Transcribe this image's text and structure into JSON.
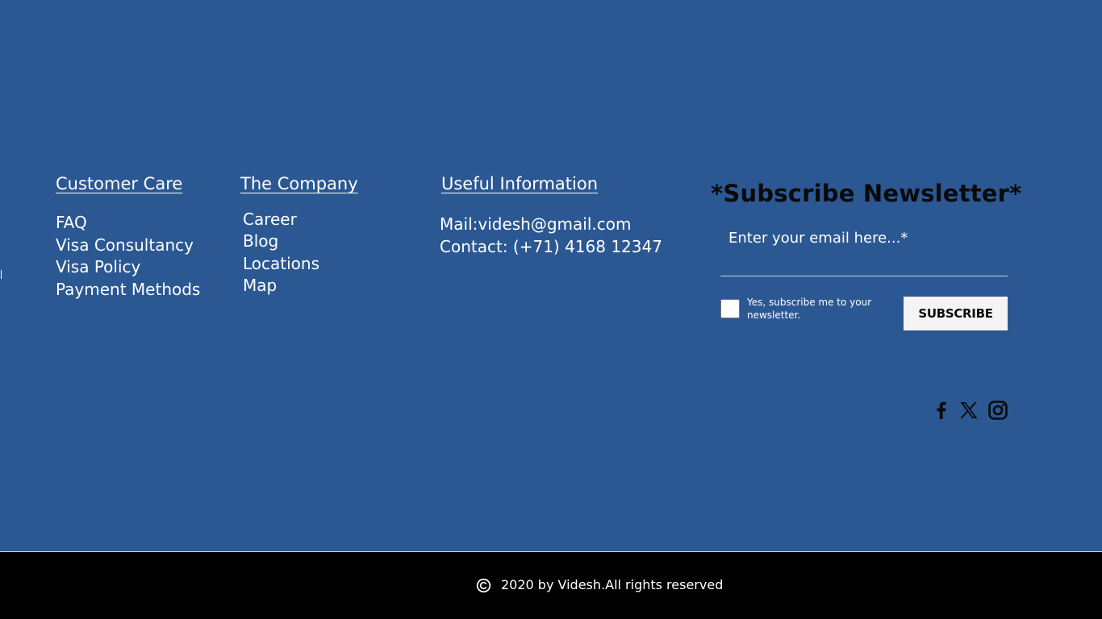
{
  "theme": {
    "background": "#2b5893",
    "text": "#ffffff",
    "title_text": "#0a0a0a",
    "footer_background": "#000000",
    "button_background": "#f4f4f4"
  },
  "customer_care": {
    "heading": "Customer Care",
    "items": [
      {
        "label": "FAQ"
      },
      {
        "label": "Visa Consultancy"
      },
      {
        "label": "Visa Policy"
      },
      {
        "label": "Payment Methods"
      }
    ]
  },
  "company": {
    "heading": "The Company",
    "items": [
      {
        "label": "Career"
      },
      {
        "label": "Blog"
      },
      {
        "label": "Locations"
      },
      {
        "label": "Map"
      }
    ]
  },
  "useful_info": {
    "heading": "Useful Information",
    "mail": "Mail:videsh@gmail.com",
    "contact": "Contact: (+71) 4168 12347"
  },
  "newsletter": {
    "title": "*Subscribe Newsletter*",
    "email_placeholder": "Enter your email here...*",
    "email_value": "",
    "consent_label": "Yes, subscribe me to your newsletter.",
    "consent_checked": false,
    "button_label": "SUBSCRIBE"
  },
  "social": [
    {
      "icon": "facebook-icon"
    },
    {
      "icon": "x-icon"
    },
    {
      "icon": "instagram-icon"
    }
  ],
  "footer": {
    "copyright_icon": "copyright-icon",
    "copyright_text": "2020 by Videsh.All rights reserved"
  }
}
